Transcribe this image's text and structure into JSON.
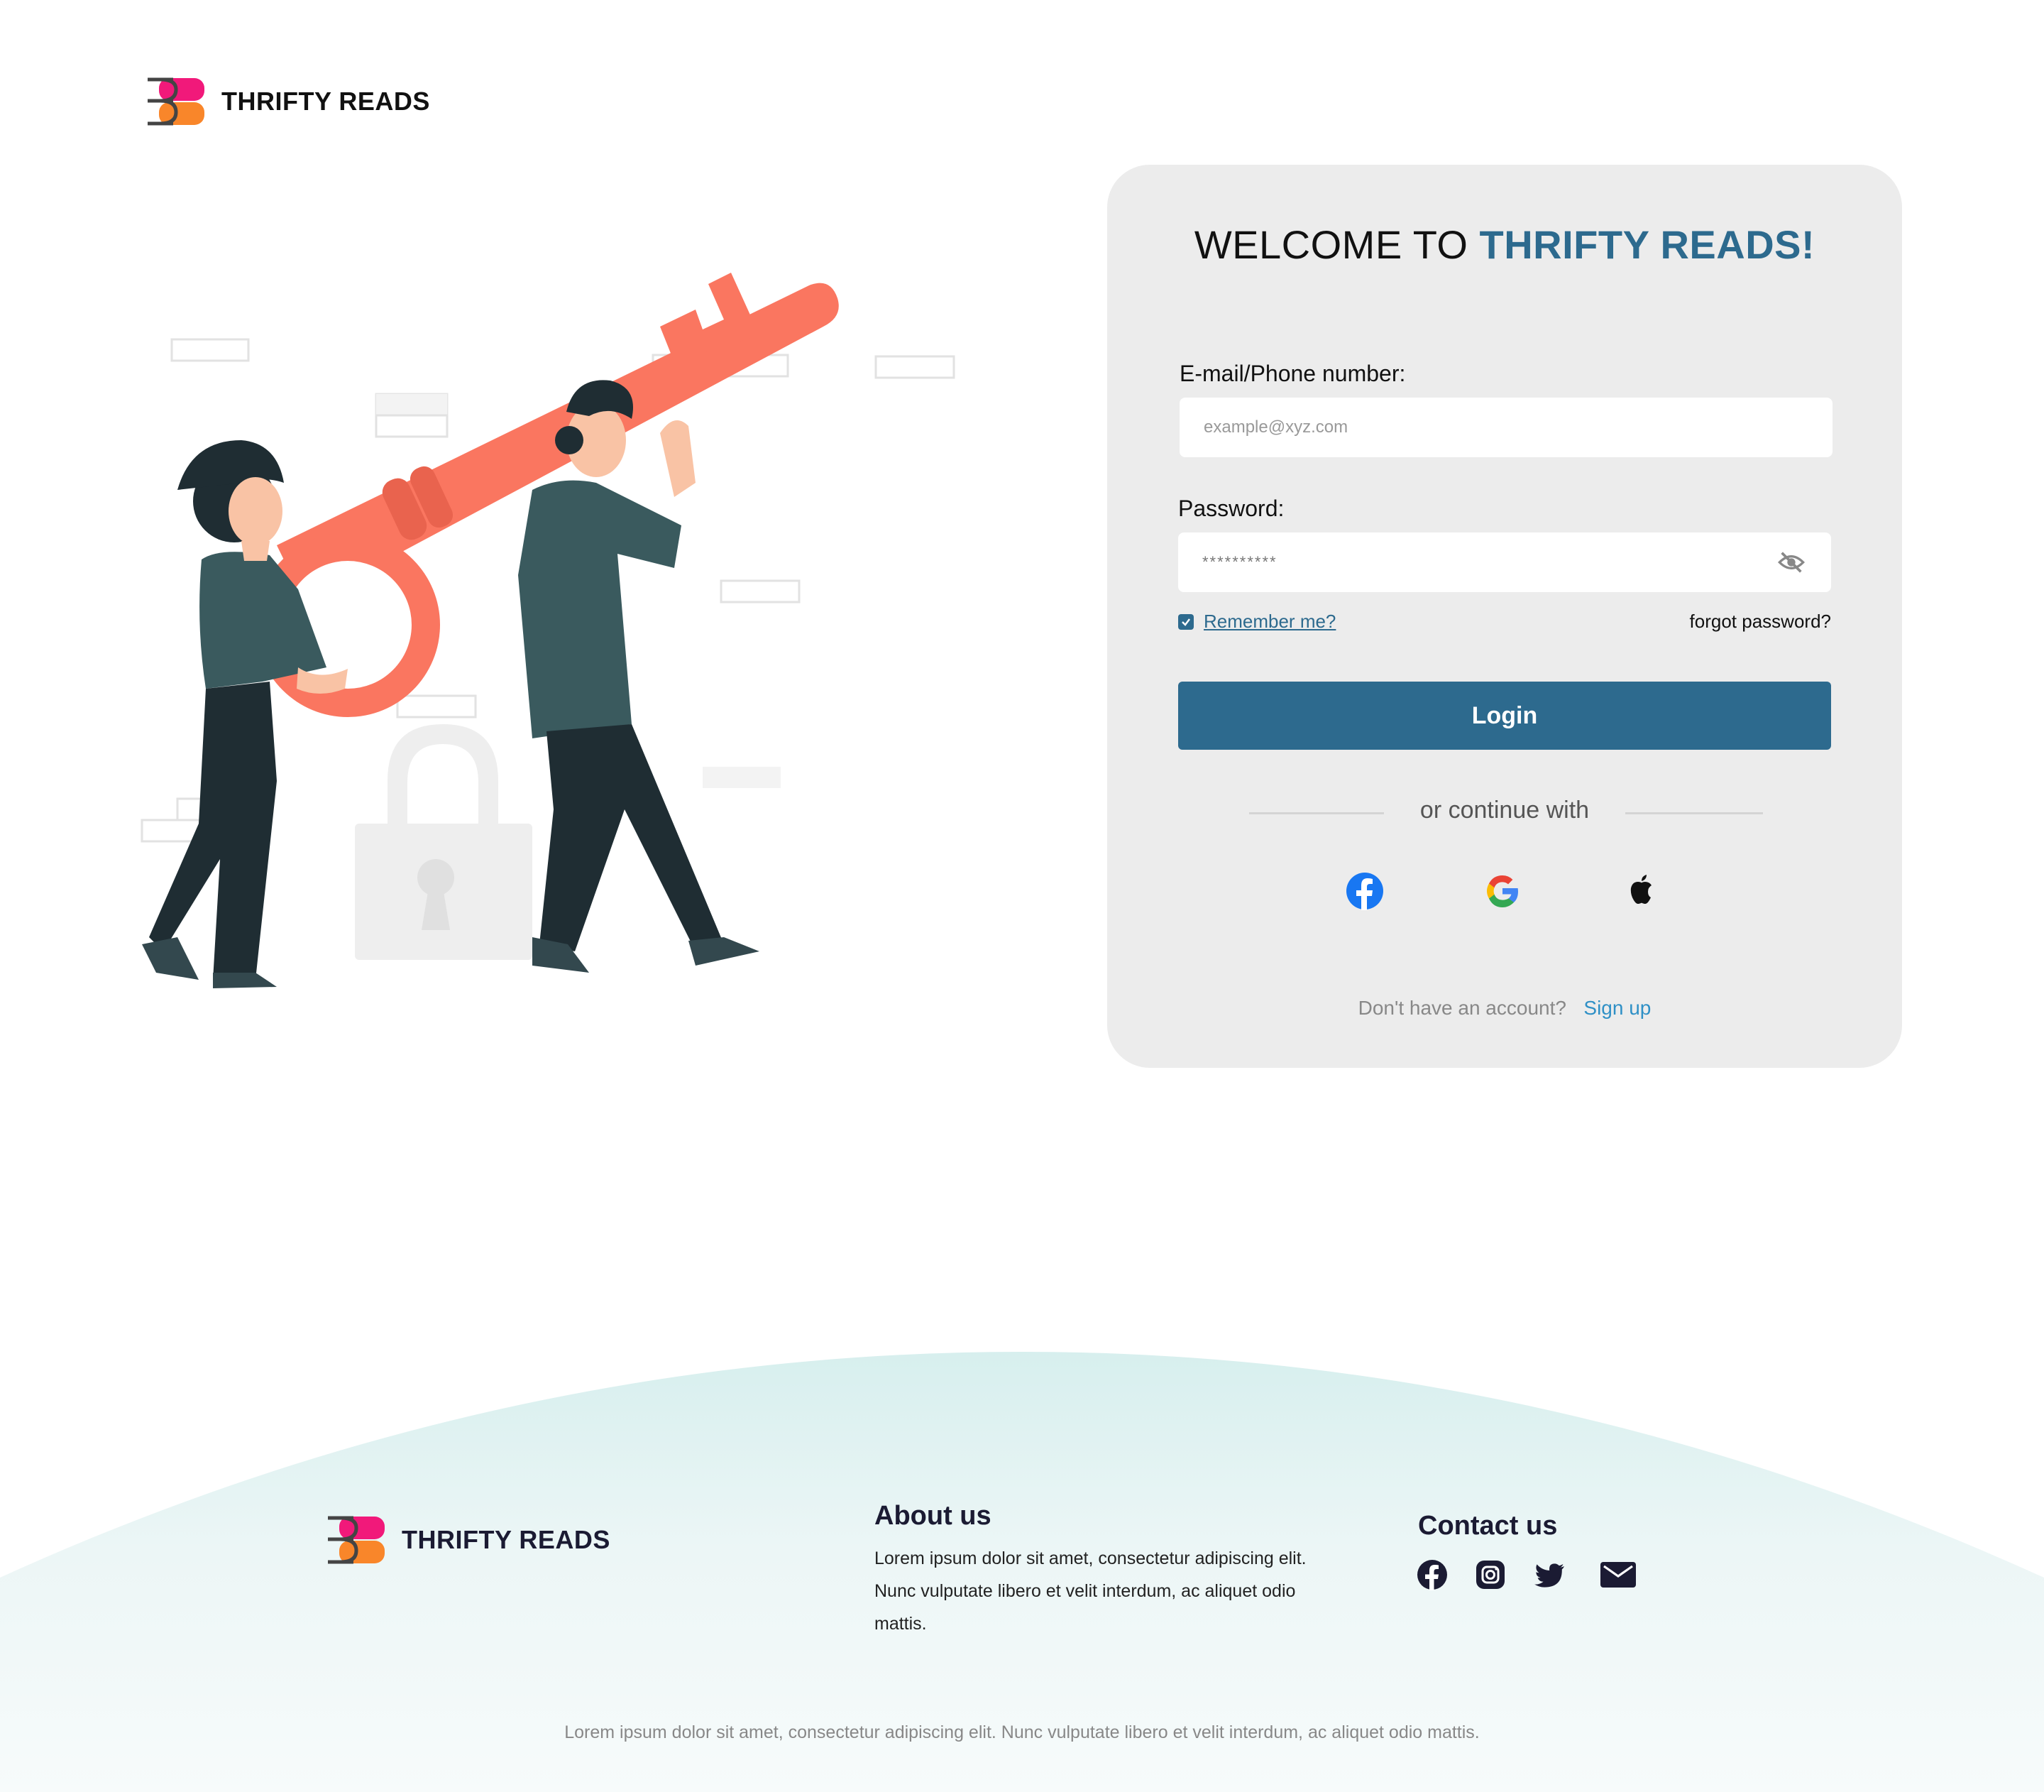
{
  "header": {
    "brand_name": "THRIFTY READS"
  },
  "login_card": {
    "welcome_prefix": "WELCOME TO",
    "welcome_brand": "THRIFTY READS!",
    "email_label": "E-mail/Phone number:",
    "email_placeholder": "example@xyz.com",
    "password_label": "Password:",
    "password_value": "**********",
    "remember_label": "Remember me?",
    "remember_checked": true,
    "forgot_label": "forgot password?",
    "login_label": "Login",
    "or_continue": "or continue with",
    "social_icons": [
      "facebook-icon",
      "google-icon",
      "apple-icon"
    ],
    "no_account": "Don't have an account?",
    "signup_label": "Sign up"
  },
  "footer": {
    "brand_name": "THRIFTY READS",
    "about_heading": "About us",
    "about_text": "Lorem ipsum dolor sit amet, consectetur adipiscing elit. Nunc vulputate libero et velit interdum, ac aliquet odio mattis.",
    "contact_heading": "Contact us",
    "contact_icons": [
      "facebook-icon",
      "instagram-icon",
      "twitter-icon",
      "mail-icon"
    ],
    "copyright": "Lorem ipsum dolor sit amet, consectetur adipiscing elit. Nunc vulputate libero et velit interdum, ac aliquet odio mattis."
  },
  "colors": {
    "accent": "#2d6a8e",
    "signup_link": "#2f90c6",
    "card_bg": "#ececec",
    "key_coral": "#fa7660",
    "logo_pink": "#f1197a",
    "logo_orange": "#f9862a"
  }
}
